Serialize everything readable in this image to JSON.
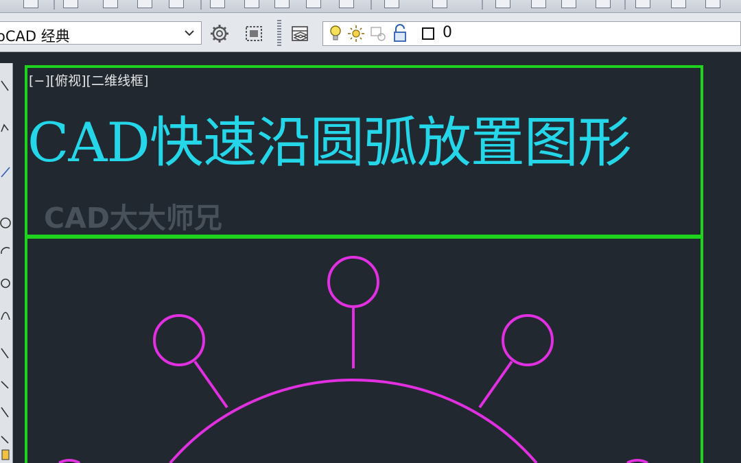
{
  "workspace": {
    "label": "oCAD 经典"
  },
  "layer": {
    "current_name": "0"
  },
  "viewport": {
    "label": "[−][俯视][二维线框]"
  },
  "drawing": {
    "title_text": "CAD快速沿圆弧放置图形",
    "watermark": "CAD大大师兄"
  },
  "colors": {
    "canvas_bg": "#212830",
    "frame_green": "#1ed21e",
    "title_cyan": "#24d6e8",
    "shape_magenta": "#e030e0"
  },
  "icons": {
    "workspace_settings": "gear-icon",
    "workspace_customize": "customize-icon",
    "layer_properties": "layer-properties-icon",
    "layer_on": "lightbulb-icon",
    "layer_freeze": "sun-icon",
    "layer_lock": "unlock-icon"
  }
}
